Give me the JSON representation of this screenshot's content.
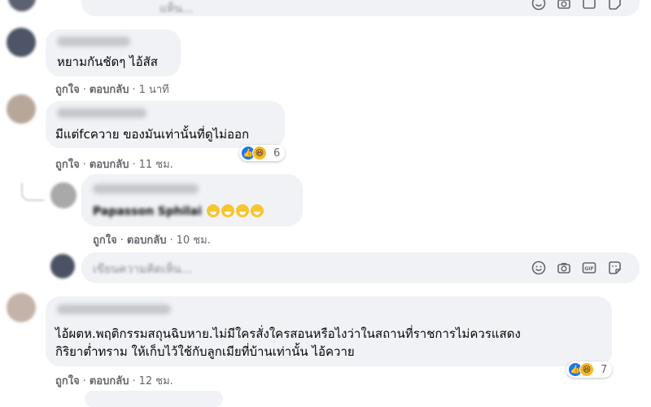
{
  "top_input": {
    "placeholder_fragment": "แท็น..."
  },
  "comments": [
    {
      "text": "หยามกันชัดๆ ไอ้สัส",
      "like_label": "ถูกใจ",
      "reply_label": "ตอบกลับ",
      "time": "1 นาที"
    },
    {
      "text": "มีแต่fcควาย ของมันเท่านั้นที่ดูไม่ออก",
      "like_label": "ถูกใจ",
      "reply_label": "ตอบกลับ",
      "time": "11 ชม.",
      "reaction_count": "6"
    },
    {
      "text_fragment": "Papasson Sphilai",
      "like_label": "ถูกใจ",
      "reply_label": "ตอบกลับ",
      "time": "10 ชม."
    },
    {
      "text_line1": "ไอ้ผตห.พฤติกรรมสถุนฉิบหาย.ไม่มีใครสั่งใครสอนหรือไงว่าในสถานที่ราชการไม่ควรแสดง",
      "text_line2": "กิริยาต่ำทราม ให้เก็บไว้ใช้กับลูกเมียที่บ้านเท่านั้น ไอ้ควาย",
      "like_label": "ถูกใจ",
      "reply_label": "ตอบกลับ",
      "time": "12 ชม.",
      "reaction_count": "7"
    }
  ],
  "reply_input": {
    "placeholder": "เขียนความคิดเห็น..."
  },
  "input_icons": [
    "emoji-icon",
    "camera-icon",
    "gif-icon",
    "sticker-icon"
  ],
  "gif_label": "GIF",
  "colors": {
    "bubble": "#f0f2f5",
    "secondary_text": "#65676b",
    "like_blue": "#1877f2",
    "haha_yellow": "#f7b928"
  }
}
